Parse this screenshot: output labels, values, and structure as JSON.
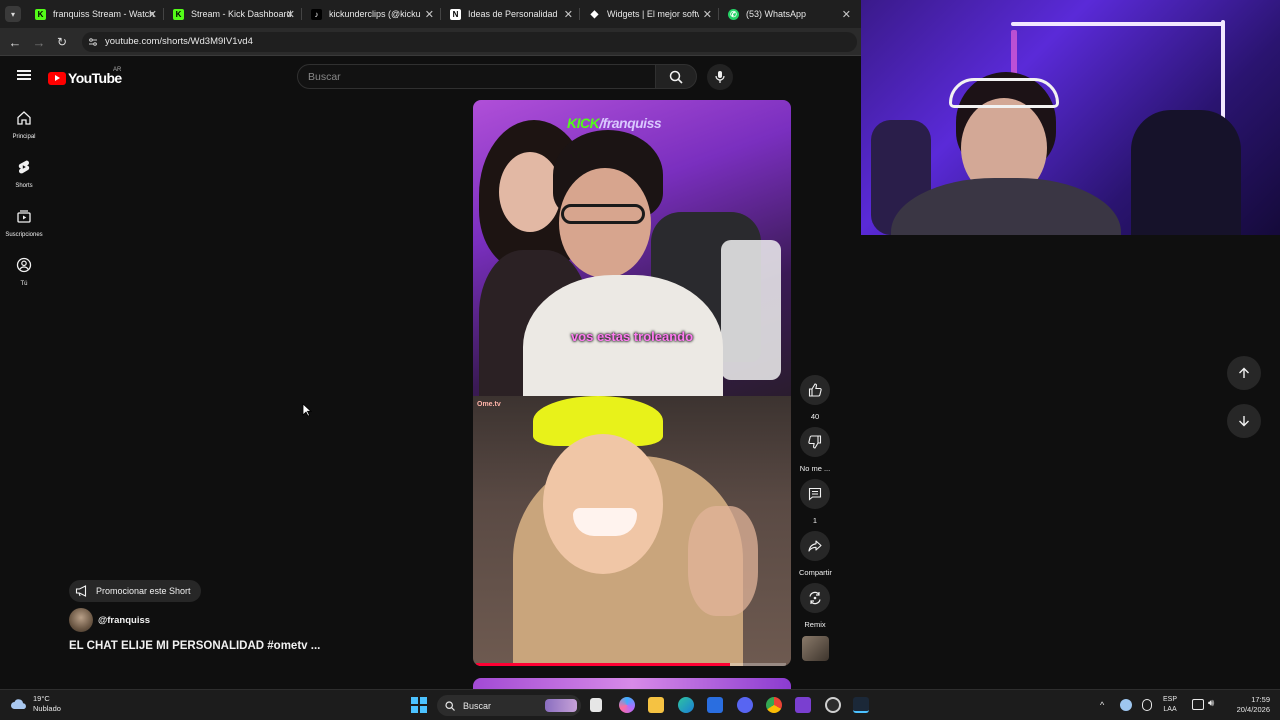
{
  "browser": {
    "tabs": [
      {
        "title": "franquiss Stream - Watch",
        "favicon": "kick-icon",
        "color": "#53fc18"
      },
      {
        "title": "Stream - Kick Dashboard",
        "favicon": "kick-icon",
        "color": "#53fc18"
      },
      {
        "title": "kickunderclips (@kickund",
        "favicon": "tiktok-icon",
        "color": "#ffffff"
      },
      {
        "title": "Ideas de Personalidad pa",
        "favicon": "notion-icon",
        "color": "#ffffff"
      },
      {
        "title": "Widgets | El mejor softw",
        "favicon": "widgets-icon",
        "color": "#ffffff"
      },
      {
        "title": "(53) WhatsApp",
        "favicon": "whatsapp-icon",
        "color": "#25d366"
      }
    ],
    "url": "youtube.com/shorts/Wd3M9IV1vd4"
  },
  "youtube": {
    "logo_text": "YouTube",
    "region": "AR",
    "search_placeholder": "Buscar",
    "guide": [
      {
        "label": "Principal",
        "icon": "home-icon"
      },
      {
        "label": "Shorts",
        "icon": "shorts-icon"
      },
      {
        "label": "Suscripciones",
        "icon": "subscriptions-icon"
      },
      {
        "label": "Tú",
        "icon": "you-icon"
      }
    ],
    "short": {
      "watermark_brand": "KICK",
      "watermark_channel": "/franquiss",
      "ometv_badge": "Ome.tv",
      "caption": "vos estas troleando",
      "progress": 0.82
    },
    "actions": {
      "like_count": "40",
      "dislike_label": "No me ...",
      "comments_count": "1",
      "share_label": "Compartir",
      "remix_label": "Remix"
    },
    "promote_label": "Promocionar este Short",
    "channel": "@franquiss",
    "title": "EL CHAT ELIJE MI PERSONALIDAD #ometv ..."
  },
  "taskbar": {
    "weather_temp": "19°C",
    "weather_desc": "Nublado",
    "search_label": "Buscar",
    "lang_top": "ESP",
    "lang_bottom": "LAA",
    "time": "17:59",
    "date": "20/4/2026"
  }
}
